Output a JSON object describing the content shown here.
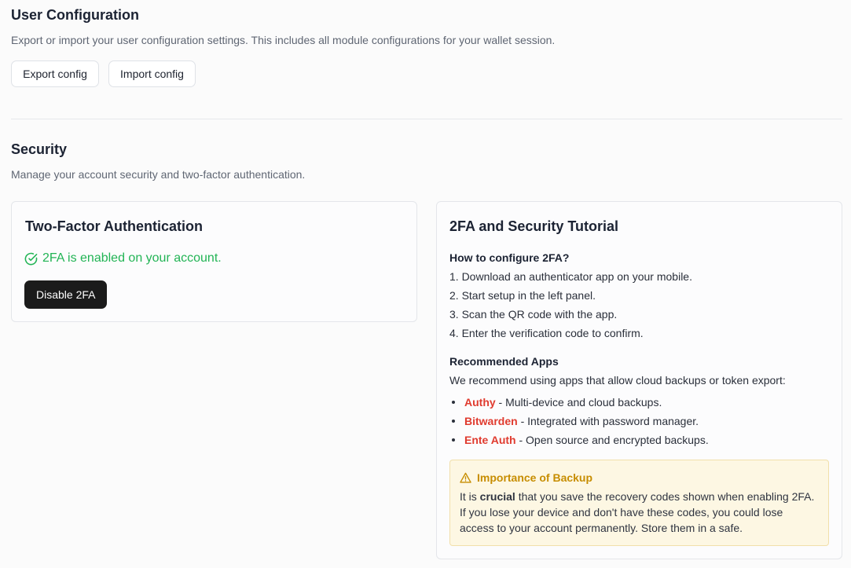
{
  "user_config": {
    "title": "User Configuration",
    "description": "Export or import your user configuration settings. This includes all module configurations for your wallet session.",
    "export_label": "Export config",
    "import_label": "Import config"
  },
  "security": {
    "title": "Security",
    "description": "Manage your account security and two-factor authentication."
  },
  "twofa_card": {
    "title": "Two-Factor Authentication",
    "status": "2FA is enabled on your account.",
    "status_color": "#22b455",
    "disable_label": "Disable 2FA"
  },
  "tutorial": {
    "title": "2FA and Security Tutorial",
    "configure_heading": "How to configure 2FA?",
    "steps": [
      "1. Download an authenticator app on your mobile.",
      "2. Start setup in the left panel.",
      "3. Scan the QR code with the app.",
      "4. Enter the verification code to confirm."
    ],
    "apps_heading": "Recommended Apps",
    "apps_intro": "We recommend using apps that allow cloud backups or token export:",
    "apps": [
      {
        "name": "Authy",
        "desc": " - Multi-device and cloud backups."
      },
      {
        "name": "Bitwarden",
        "desc": " - Integrated with password manager."
      },
      {
        "name": "Ente Auth",
        "desc": " - Open source and encrypted backups."
      }
    ],
    "accent_color": "#e03b2f",
    "warning": {
      "title": "Importance of Backup",
      "pre": "It is ",
      "strong": "crucial",
      "post": " that you save the recovery codes shown when enabling 2FA.",
      "line2": "If you lose your device and don't have these codes, you could lose",
      "line3": "access to your account permanently. Store them in a safe."
    }
  }
}
